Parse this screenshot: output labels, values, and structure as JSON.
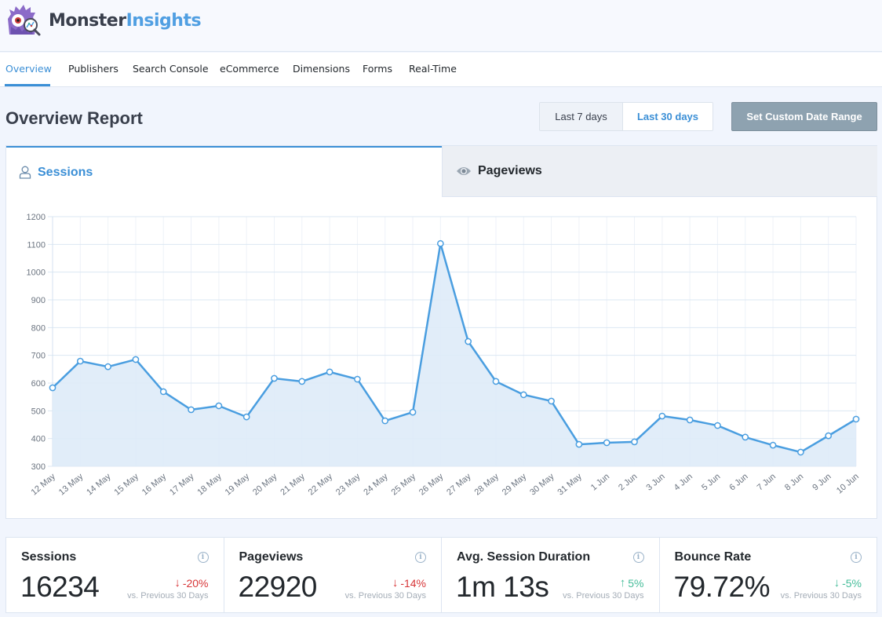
{
  "brand": {
    "name_part1": "Monster",
    "name_part2": "Insights",
    "primary_color": "#509fe2",
    "text_color": "#393f4c"
  },
  "nav": {
    "items": [
      {
        "label": "Overview",
        "active": true
      },
      {
        "label": "Publishers",
        "active": false
      },
      {
        "label": "Search Console",
        "active": false
      },
      {
        "label": "eCommerce",
        "active": false
      },
      {
        "label": "Dimensions",
        "active": false
      },
      {
        "label": "Forms",
        "active": false
      },
      {
        "label": "Real-Time",
        "active": false
      }
    ]
  },
  "header": {
    "title": "Overview Report",
    "range_options": [
      {
        "label": "Last 7 days",
        "selected": false
      },
      {
        "label": "Last 30 days",
        "selected": true
      }
    ],
    "custom_range_label": "Set Custom Date Range"
  },
  "chart_tabs": [
    {
      "label": "Sessions",
      "icon": "user-icon",
      "active": true
    },
    {
      "label": "Pageviews",
      "icon": "eye-icon",
      "active": false
    }
  ],
  "chart_data": {
    "type": "area",
    "title": "",
    "xlabel": "",
    "ylabel": "",
    "ylim": [
      300,
      1200
    ],
    "yticks": [
      300,
      400,
      500,
      600,
      700,
      800,
      900,
      1000,
      1100,
      1200
    ],
    "grid": true,
    "legend": "none",
    "x": [
      "12 May",
      "13 May",
      "14 May",
      "15 May",
      "16 May",
      "17 May",
      "18 May",
      "19 May",
      "20 May",
      "21 May",
      "22 May",
      "23 May",
      "24 May",
      "25 May",
      "26 May",
      "27 May",
      "28 May",
      "29 May",
      "30 May",
      "31 May",
      "1 Jun",
      "2 Jun",
      "3 Jun",
      "4 Jun",
      "5 Jun",
      "6 Jun",
      "7 Jun",
      "8 Jun",
      "9 Jun",
      "10 Jun"
    ],
    "series": [
      {
        "name": "Sessions",
        "color": "#4a9ee0",
        "fill": "#deebf8",
        "values": [
          583,
          679,
          659,
          685,
          569,
          504,
          518,
          478,
          617,
          606,
          640,
          614,
          464,
          495,
          1103,
          750,
          606,
          558,
          535,
          379,
          385,
          388,
          481,
          467,
          447,
          405,
          376,
          351,
          410,
          470
        ]
      }
    ]
  },
  "stats": [
    {
      "title": "Sessions",
      "value": "16234",
      "change": "-20%",
      "direction": "down",
      "sentiment": "bad",
      "compare": "vs. Previous 30 Days"
    },
    {
      "title": "Pageviews",
      "value": "22920",
      "change": "-14%",
      "direction": "down",
      "sentiment": "bad",
      "compare": "vs. Previous 30 Days"
    },
    {
      "title": "Avg. Session Duration",
      "value": "1m 13s",
      "change": "5%",
      "direction": "up",
      "sentiment": "good",
      "compare": "vs. Previous 30 Days"
    },
    {
      "title": "Bounce Rate",
      "value": "79.72%",
      "change": "-5%",
      "direction": "down",
      "sentiment": "good",
      "compare": "vs. Previous 30 Days"
    }
  ]
}
